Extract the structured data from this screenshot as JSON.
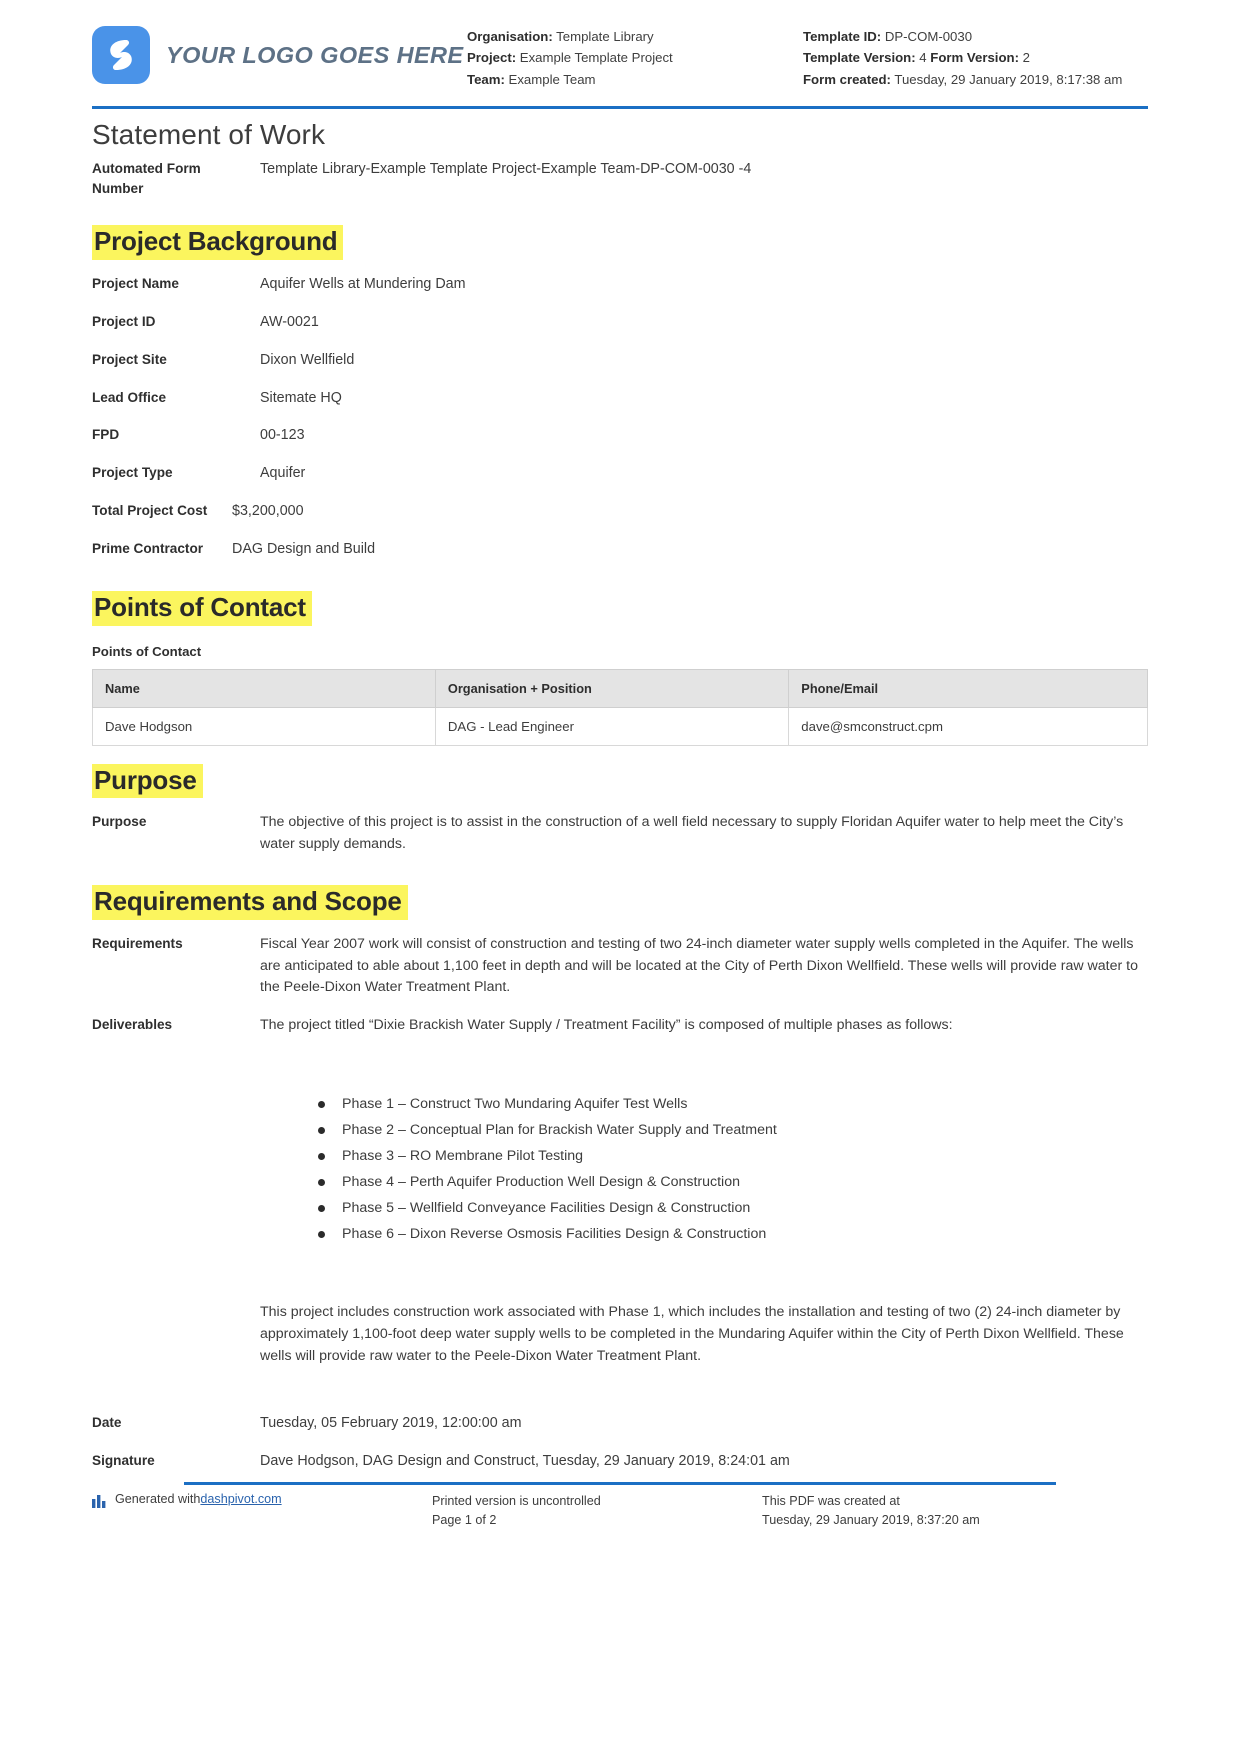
{
  "header": {
    "logo_text": "YOUR LOGO GOES HERE",
    "left_meta": [
      {
        "label": "Organisation:",
        "value": " Template Library"
      },
      {
        "label": "Project:",
        "value": " Example Template Project"
      },
      {
        "label": "Team:",
        "value": " Example Team"
      }
    ],
    "right_meta": [
      {
        "label": "Template ID:",
        "value": " DP-COM-0030"
      },
      {
        "label": "Template Version:",
        "value": " 4 ",
        "label2": "Form Version:",
        "value2": " 2"
      },
      {
        "label": "Form created:",
        "value": " Tuesday, 29 January 2019, 8:17:38 am"
      }
    ]
  },
  "document": {
    "title": "Statement of Work",
    "automated_form_number_label": "Automated Form Number",
    "automated_form_number_value": "Template Library-Example Template Project-Example Team-DP-COM-0030   -4"
  },
  "project_background": {
    "heading": "Project Background",
    "fields": [
      {
        "label": "Project Name",
        "value": "Aquifer Wells at Mundering Dam"
      },
      {
        "label": "Project ID",
        "value": "AW-0021"
      },
      {
        "label": "Project Site",
        "value": "Dixon Wellfield"
      },
      {
        "label": "Lead Office",
        "value": "Sitemate HQ"
      },
      {
        "label": "FPD",
        "value": "00-123"
      },
      {
        "label": "Project Type",
        "value": "Aquifer"
      },
      {
        "label": "Total Project Cost",
        "value": "$3,200,000"
      },
      {
        "label": "Prime Contractor",
        "value": "DAG Design and Build"
      }
    ]
  },
  "points_of_contact": {
    "heading": "Points of Contact",
    "sub_label": "Points of Contact",
    "columns": [
      "Name",
      "Organisation + Position",
      "Phone/Email"
    ],
    "rows": [
      [
        "Dave Hodgson",
        "DAG - Lead Engineer",
        "dave@smconstruct.cpm"
      ]
    ]
  },
  "purpose": {
    "heading": "Purpose",
    "field_label": "Purpose",
    "text": "The objective of this project is to assist in the construction of a well field necessary to supply Floridan Aquifer water to help meet the City’s water supply demands."
  },
  "requirements_and_scope": {
    "heading": "Requirements and Scope",
    "requirements_label": "Requirements",
    "requirements_text": "Fiscal Year 2007 work will consist of construction and testing of two 24-inch diameter water supply wells completed in the Aquifer. The wells are anticipated to able about 1,100 feet in depth and will be located at the City of Perth Dixon Wellfield. These wells will provide raw water to the Peele-Dixon Water Treatment Plant.",
    "deliverables_label": "Deliverables",
    "deliverables_intro": "The project titled “Dixie Brackish Water Supply / Treatment Facility” is composed of multiple phases as follows:",
    "phases": [
      "Phase 1 – Construct Two Mundaring Aquifer Test Wells",
      "Phase 2 – Conceptual Plan for Brackish Water Supply and Treatment",
      "Phase 3 – RO Membrane Pilot Testing",
      "Phase 4 – Perth Aquifer Production Well Design & Construction",
      "Phase 5 – Wellfield Conveyance Facilities Design & Construction",
      "Phase 6 – Dixon Reverse Osmosis Facilities Design & Construction"
    ],
    "deliverables_outro": "This project includes construction work associated with Phase 1, which includes the installation and testing of two (2) 24-inch diameter by approximately 1,100-foot deep water supply wells to be completed in the Mundaring Aquifer within the City of Perth Dixon Wellfield. These wells will provide raw water to the Peele-Dixon Water Treatment Plant.",
    "date_label": "Date",
    "date_value": "Tuesday, 05 February 2019, 12:00:00 am",
    "signature_label": "Signature",
    "signature_value": "Dave Hodgson, DAG Design and Construct, Tuesday, 29 January 2019, 8:24:01 am"
  },
  "footer": {
    "generated_prefix": "Generated with ",
    "generated_link": "dashpivot.com",
    "uncontrolled_text": "Printed version is uncontrolled",
    "page_text": "Page 1 of 2",
    "created_text": "This PDF was created at",
    "created_time": "Tuesday, 29 January 2019, 8:37:20 am"
  },
  "colors": {
    "accent_blue": "#1b6fc4",
    "logo_blue": "#4a93e8",
    "highlight_yellow": "#fbf55e"
  }
}
